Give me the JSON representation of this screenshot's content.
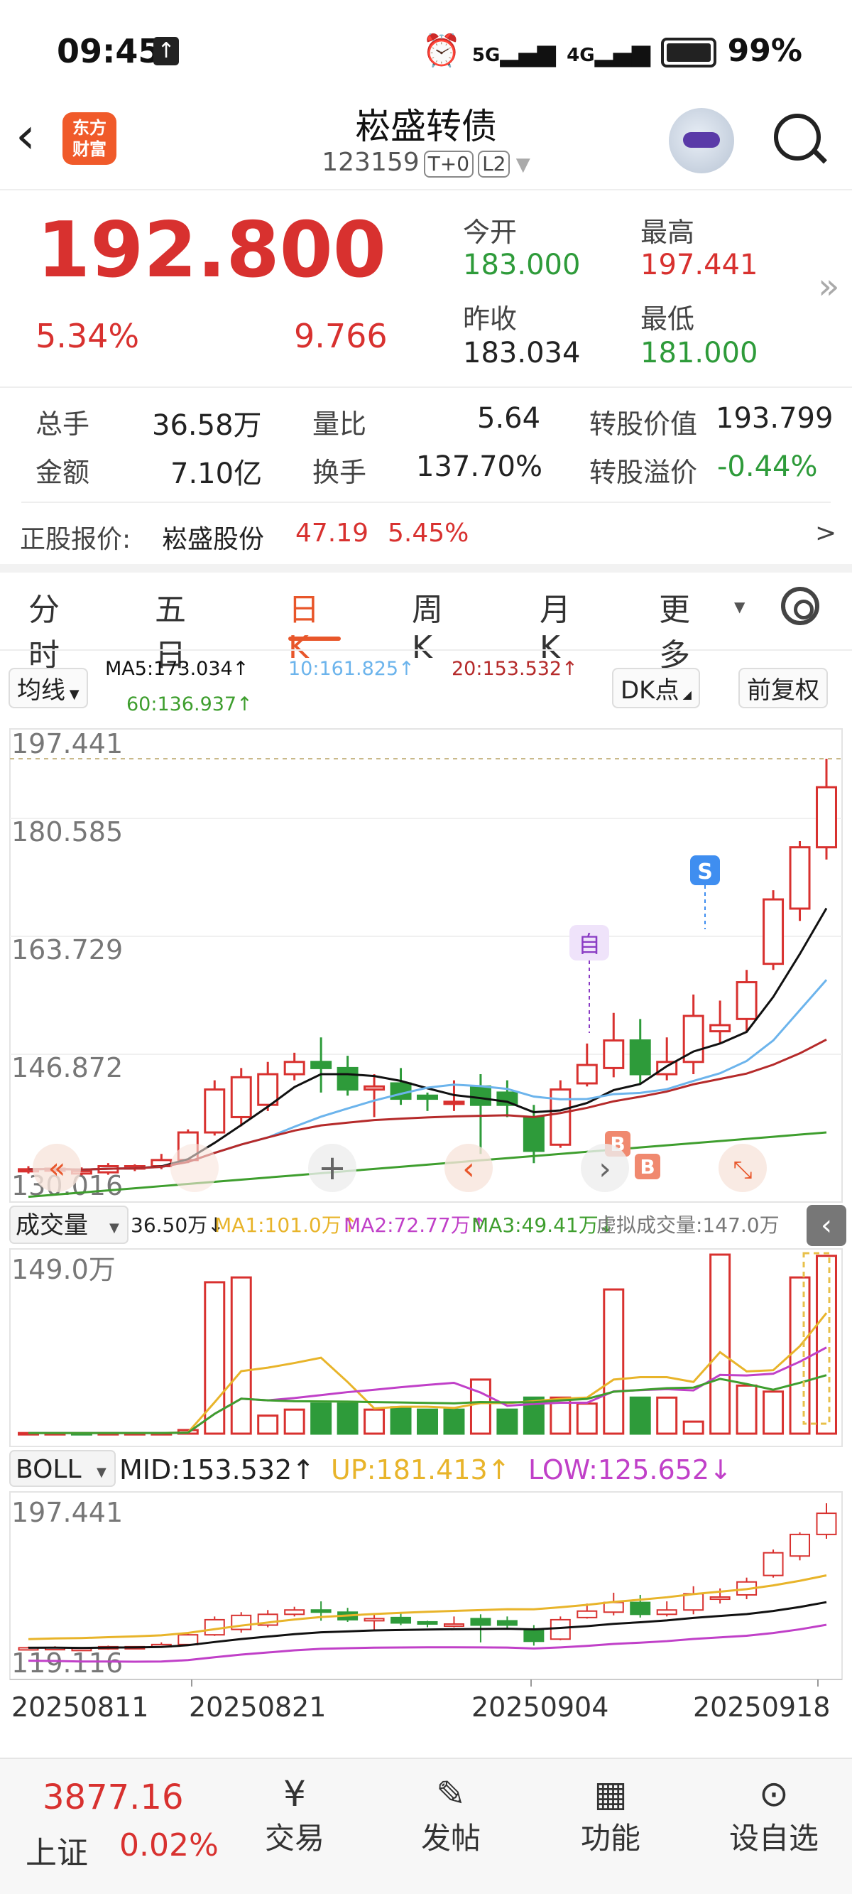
{
  "status": {
    "time": "09:45",
    "net1": "5G",
    "net2": "4G",
    "battery": "99%"
  },
  "header": {
    "logo_top": "东方",
    "logo_bottom": "财富",
    "title": "崧盛转债",
    "code": "123159",
    "tag1": "T+0",
    "tag2": "L2"
  },
  "quote": {
    "price": "192.800",
    "change_pct": "5.34%",
    "change": "9.766",
    "open_label": "今开",
    "open": "183.000",
    "high_label": "最高",
    "high": "197.441",
    "prev_label": "昨收",
    "prev": "183.034",
    "low_label": "最低",
    "low": "181.000"
  },
  "stats": {
    "vol_label": "总手",
    "vol": "36.58万",
    "vr_label": "量比",
    "vr": "5.64",
    "cv_label": "转股价值",
    "cv": "193.799",
    "amt_label": "金额",
    "amt": "7.10亿",
    "turn_label": "换手",
    "turn": "137.70%",
    "prem_label": "转股溢价",
    "prem": "-0.44%"
  },
  "underlying": {
    "label": "正股报价:",
    "name": "崧盛股份",
    "price": "47.19",
    "pct": "5.45%",
    "arrow": ">"
  },
  "tabs": [
    "分时",
    "五日",
    "日K",
    "周K",
    "月K",
    "更多"
  ],
  "indicators": {
    "ma_btn": "均线",
    "ma5": "MA5:173.034↑",
    "ma10": "10:161.825↑",
    "ma20": "20:153.532↑",
    "ma60": "60:136.937↑",
    "dk_btn": "DK点",
    "fq_btn": "前复权"
  },
  "kline": {
    "y_labels": [
      "197.441",
      "180.585",
      "163.729",
      "146.872",
      "130.016"
    ],
    "marker_zi": "自",
    "marker_s": "S",
    "marker_b": "B"
  },
  "volume": {
    "btn": "成交量",
    "v": "36.50万↓",
    "ma1": "MA1:101.0万↑",
    "ma2": "MA2:72.77万↑",
    "ma3": "MA3:49.41万↓",
    "virtual": "虚拟成交量:147.0万",
    "ymax": "149.0万"
  },
  "boll": {
    "btn": "BOLL",
    "mid": "MID:153.532↑",
    "up": "UP:181.413↑",
    "low": "LOW:125.652↓",
    "ymax": "197.441",
    "ymin": "119.116"
  },
  "dates": [
    "20250811",
    "20250821",
    "20250904",
    "20250918"
  ],
  "nav": {
    "index_value": "3877.16",
    "index_name": "上证",
    "index_pct": "0.02%",
    "trade": "交易",
    "post": "发帖",
    "func": "功能",
    "watch": "设自选"
  },
  "colors": {
    "up": "#d8312f",
    "down": "#2e9b3a",
    "ma5": "#111111",
    "ma10": "#6cb4ec",
    "ma20": "#b52a2a",
    "ma60": "#3e9e2e",
    "accent": "#f05a2a"
  },
  "chart_data": {
    "type": "candlestick",
    "candles": [
      {
        "o": 130.2,
        "c": 130.5,
        "h": 131.0,
        "l": 129.8
      },
      {
        "o": 130.3,
        "c": 130.6,
        "h": 131.2,
        "l": 129.9
      },
      {
        "o": 129.8,
        "c": 130.2,
        "h": 130.8,
        "l": 129.5
      },
      {
        "o": 130.0,
        "c": 131.0,
        "h": 131.5,
        "l": 129.6
      },
      {
        "o": 130.6,
        "c": 131.0,
        "h": 131.3,
        "l": 130.2
      },
      {
        "o": 131.0,
        "c": 132.0,
        "h": 133.0,
        "l": 130.5
      },
      {
        "o": 132.0,
        "c": 136.5,
        "h": 137.0,
        "l": 131.5
      },
      {
        "o": 136.5,
        "c": 143.5,
        "h": 145.0,
        "l": 136.0
      },
      {
        "o": 139.0,
        "c": 145.5,
        "h": 147.0,
        "l": 137.5
      },
      {
        "o": 141.0,
        "c": 146.0,
        "h": 148.0,
        "l": 140.0
      },
      {
        "o": 146.0,
        "c": 148.0,
        "h": 149.5,
        "l": 145.0
      },
      {
        "o": 148.0,
        "c": 147.0,
        "h": 152.0,
        "l": 143.0
      },
      {
        "o": 147.0,
        "c": 143.5,
        "h": 149.0,
        "l": 142.5
      },
      {
        "o": 143.5,
        "c": 144.0,
        "h": 146.0,
        "l": 139.0
      },
      {
        "o": 144.5,
        "c": 142.0,
        "h": 147.0,
        "l": 141.0
      },
      {
        "o": 142.5,
        "c": 142.0,
        "h": 143.0,
        "l": 140.0
      },
      {
        "o": 141.5,
        "c": 141.5,
        "h": 145.0,
        "l": 140.0
      },
      {
        "o": 144.0,
        "c": 141.0,
        "h": 146.0,
        "l": 133.0
      },
      {
        "o": 143.0,
        "c": 141.0,
        "h": 145.0,
        "l": 139.0
      },
      {
        "o": 139.0,
        "c": 133.5,
        "h": 141.0,
        "l": 131.5
      },
      {
        "o": 134.5,
        "c": 143.5,
        "h": 145.0,
        "l": 134.0
      },
      {
        "o": 144.5,
        "c": 147.5,
        "h": 151.0,
        "l": 144.0
      },
      {
        "o": 147.0,
        "c": 151.5,
        "h": 156.0,
        "l": 145.5
      },
      {
        "o": 151.5,
        "c": 146.0,
        "h": 155.0,
        "l": 144.5
      },
      {
        "o": 146.0,
        "c": 148.0,
        "h": 152.0,
        "l": 145.0
      },
      {
        "o": 148.0,
        "c": 155.5,
        "h": 159.0,
        "l": 146.0
      },
      {
        "o": 153.0,
        "c": 154.0,
        "h": 158.0,
        "l": 151.0
      },
      {
        "o": 155.0,
        "c": 161.0,
        "h": 163.0,
        "l": 153.0
      },
      {
        "o": 164.0,
        "c": 174.5,
        "h": 176.0,
        "l": 163.0
      },
      {
        "o": 173.0,
        "c": 183.0,
        "h": 184.0,
        "l": 171.0
      },
      {
        "o": 183.0,
        "c": 192.8,
        "h": 197.441,
        "l": 181.0
      }
    ],
    "ylim": [
      130.016,
      197.441
    ],
    "volume": [
      0.5,
      0.5,
      0.5,
      0.5,
      0.5,
      0.5,
      3,
      126,
      130,
      15,
      20,
      25,
      25,
      20,
      22,
      20,
      20,
      45,
      20,
      30,
      30,
      25,
      120,
      30,
      30,
      10,
      149,
      40,
      35,
      130,
      148,
      36.5
    ],
    "volume_up": [
      true,
      true,
      false,
      true,
      true,
      true,
      true,
      true,
      true,
      true,
      true,
      false,
      false,
      true,
      false,
      false,
      false,
      true,
      false,
      false,
      true,
      true,
      true,
      false,
      true,
      true,
      true,
      true,
      true,
      true,
      true,
      true
    ],
    "boll_ylim": [
      119.116,
      197.441
    ]
  }
}
